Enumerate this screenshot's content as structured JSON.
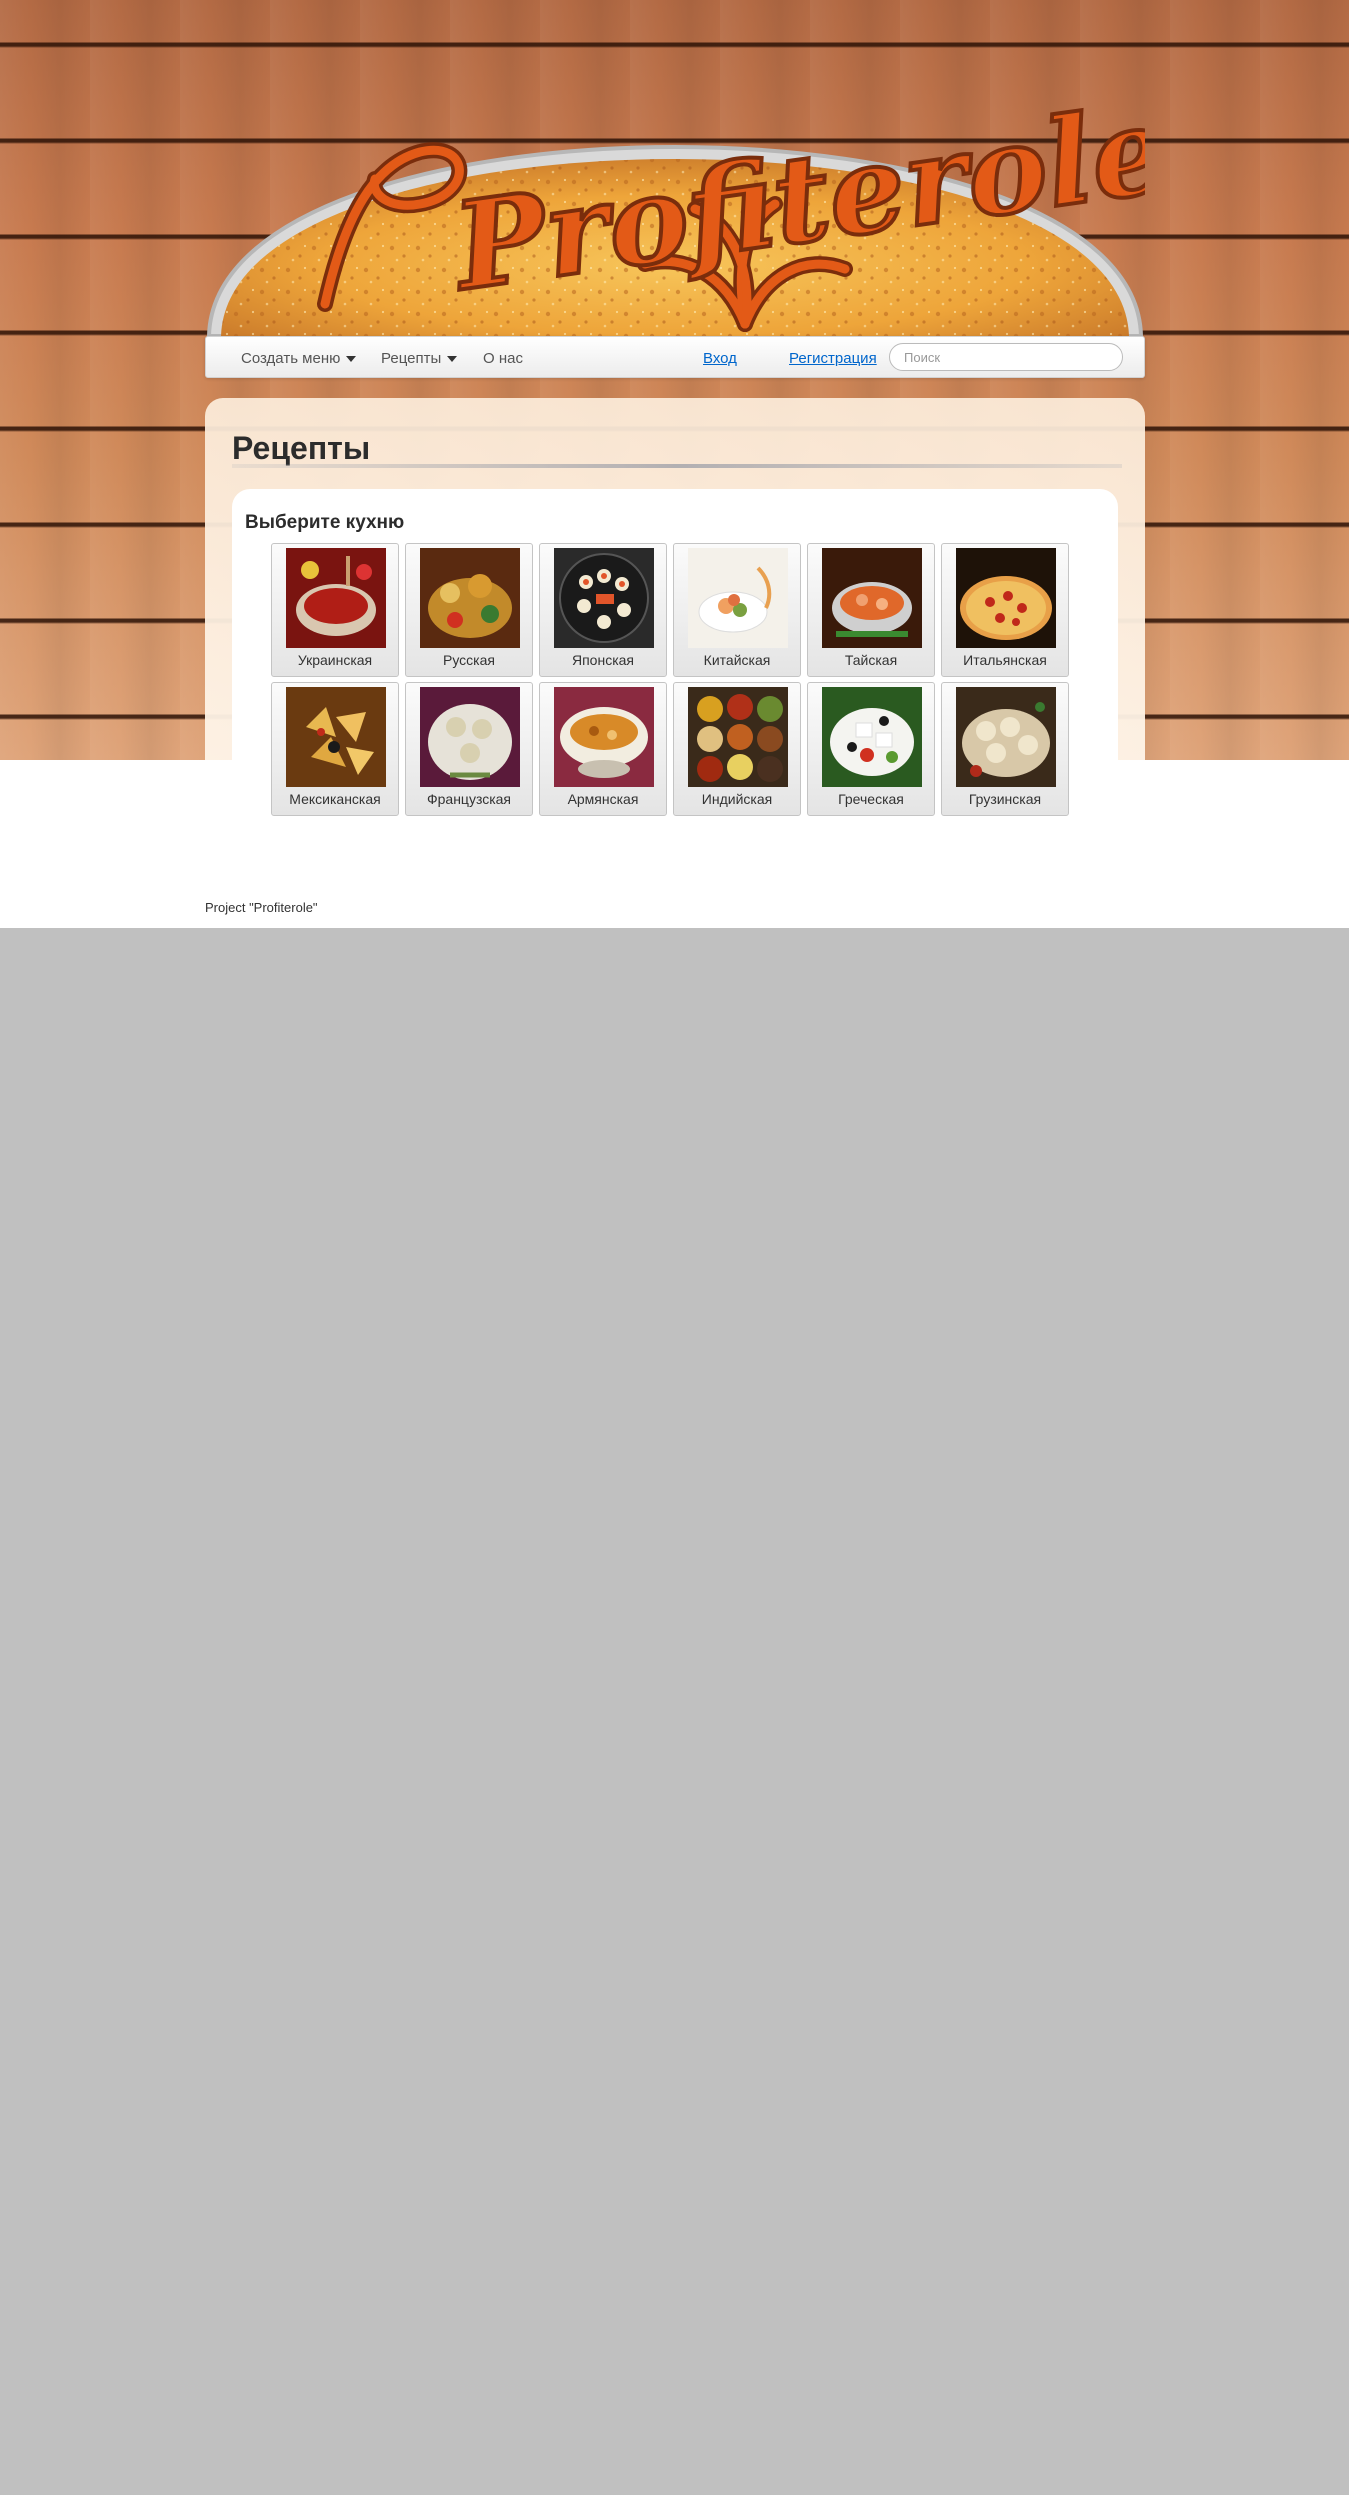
{
  "brand": {
    "logo_text": "Profiterole"
  },
  "nav": {
    "create_menu": "Создать меню",
    "recipes": "Рецепты",
    "about": "О нас",
    "login": "Вход",
    "register": "Регистрация",
    "search_placeholder": "Поиск"
  },
  "page": {
    "title": "Рецепты"
  },
  "cuisines": {
    "heading": "Выберите кухню",
    "items": [
      {
        "label": "Украинская"
      },
      {
        "label": "Русская"
      },
      {
        "label": "Японская"
      },
      {
        "label": "Китайская"
      },
      {
        "label": "Тайская"
      },
      {
        "label": "Итальянская"
      },
      {
        "label": "Мексиканская"
      },
      {
        "label": "Французская"
      },
      {
        "label": "Армянская"
      },
      {
        "label": "Индийская"
      },
      {
        "label": "Греческая"
      },
      {
        "label": "Грузинская"
      }
    ]
  },
  "footer": {
    "text": "Project \"Profiterole\""
  }
}
